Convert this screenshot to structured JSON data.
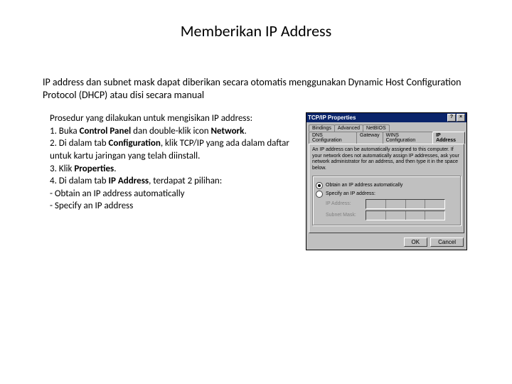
{
  "title": "Memberikan IP Address",
  "intro": "IP address dan subnet mask dapat diberikan secara otomatis menggunakan Dynamic Host Configuration Protocol (DHCP) atau disi secara manual",
  "proc": {
    "lead": "Prosedur yang dilakukan untuk mengisikan IP address:",
    "s1a": "1. Buka ",
    "s1b": "Control Panel",
    "s1c": " dan double-klik icon ",
    "s1d": "Network",
    "s1e": ".",
    "s2a": "2. Di dalam tab ",
    "s2b": "Configuration",
    "s2c": ", klik TCP/IP yang ada dalam daftar untuk kartu jaringan yang telah diinstall.",
    "s3a": "3. Klik ",
    "s3b": "Properties",
    "s3c": ".",
    "s4a": "4. Di dalam tab ",
    "s4b": "IP Address",
    "s4c": ", terdapat 2 pilihan:",
    "opt1": " - Obtain an IP address automatically",
    "opt2": " - Specify an IP address"
  },
  "dlg": {
    "title": "TCP/IP Properties",
    "tabs_row1": [
      "Bindings",
      "Advanced",
      "NetBIOS"
    ],
    "tabs_row2": [
      "DNS Configuration",
      "Gateway",
      "WINS Configuration",
      "IP Address"
    ],
    "desc": "An IP address can be automatically assigned to this computer. If your network does not automatically assign IP addresses, ask your network administrator for an address, and then type it in the space below.",
    "radio1": "Obtain an IP address automatically",
    "radio2": "Specify an IP address:",
    "ip_label": "IP Address:",
    "mask_label": "Subnet Mask:",
    "ok": "OK",
    "cancel": "Cancel"
  }
}
